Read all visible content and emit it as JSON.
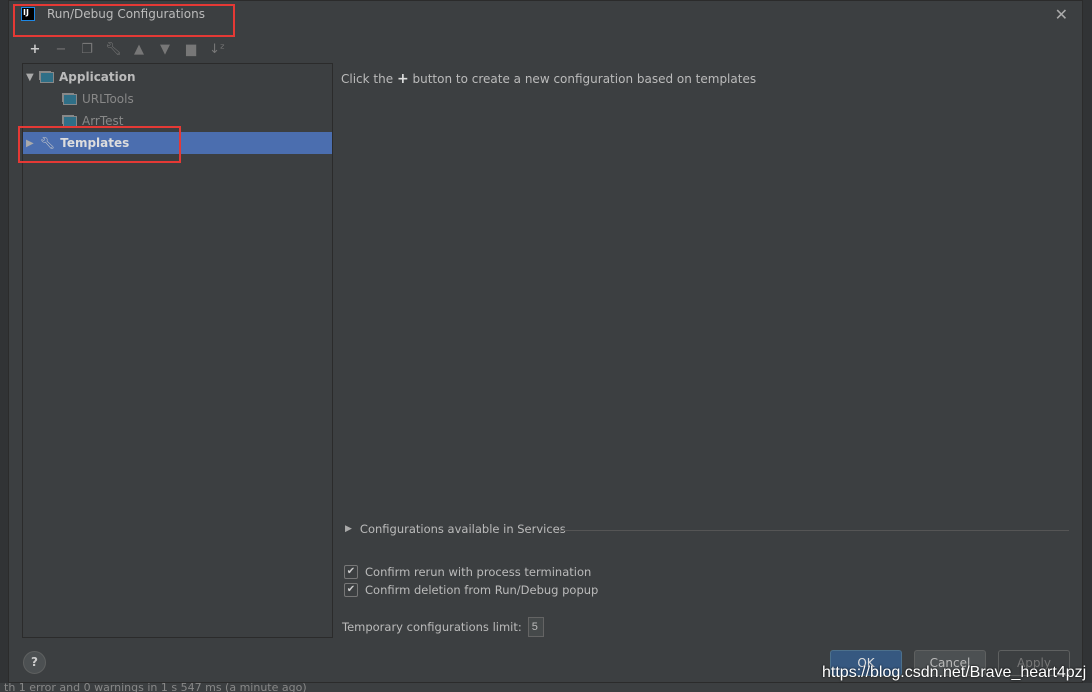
{
  "dialog": {
    "title": "Run/Debug Configurations",
    "logo": "IJ"
  },
  "toolbar": {
    "icons": [
      "plus-icon",
      "minus-icon",
      "copy-icon",
      "wrench-icon",
      "arrow-up-icon",
      "arrow-down-icon",
      "new-folder-icon",
      "sort-alpha-icon"
    ]
  },
  "tree": {
    "application": "Application",
    "children": [
      "URLTools",
      "ArrTest"
    ],
    "templates": "Templates"
  },
  "main": {
    "hint_before": "Click the",
    "hint_after": "button to create a new configuration based on templates",
    "services": "Configurations available in Services",
    "confirm_rerun": "Confirm rerun with process termination",
    "confirm_deletion": "Confirm deletion from Run/Debug popup",
    "temp_limit_label": "Temporary configurations limit:",
    "temp_limit_value": "5"
  },
  "buttons": {
    "ok": "OK",
    "cancel": "Cancel",
    "apply": "Apply",
    "help": "?"
  },
  "background": {
    "status": "th 1 error and 0 warnings in 1 s 547 ms (a minute ago)"
  },
  "watermark": "https://blog.csdn.net/Brave_heart4pzj",
  "colors": {
    "selection": "#4b6eaf",
    "highlight_box": "#e53935",
    "ok": "#365880"
  }
}
